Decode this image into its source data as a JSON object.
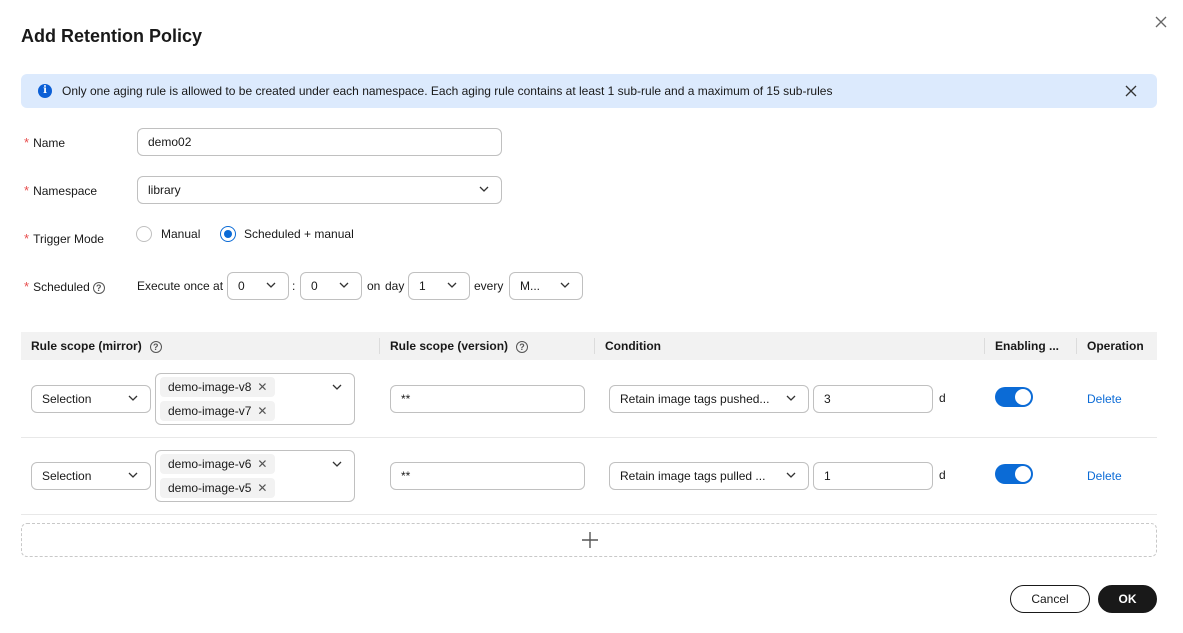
{
  "dialog": {
    "title": "Add Retention Policy"
  },
  "alert": {
    "text": "Only one aging rule is allowed to be created under each namespace. Each aging rule contains at least 1 sub-rule and a maximum of 15 sub-rules"
  },
  "form": {
    "name": {
      "label": "Name",
      "value": "demo02"
    },
    "namespace": {
      "label": "Namespace",
      "value": "library"
    },
    "trigger_mode": {
      "label": "Trigger Mode",
      "options": [
        "Manual",
        "Scheduled + manual"
      ],
      "selected": "Scheduled + manual"
    },
    "scheduled": {
      "label": "Scheduled",
      "prefix": "Execute once at",
      "hour": "0",
      "colon": ":",
      "minute": "0",
      "on_text": "on",
      "day_text": "day",
      "day": "1",
      "every_text": "every",
      "period": "M..."
    }
  },
  "table": {
    "headers": {
      "scope_mirror": "Rule scope (mirror)",
      "scope_version": "Rule scope (version)",
      "condition": "Condition",
      "enabling": "Enabling ...",
      "operation": "Operation"
    },
    "rows": [
      {
        "scope_select": "Selection",
        "tags": [
          "demo-image-v8",
          "demo-image-v7"
        ],
        "version": "**",
        "condition": "Retain image tags pushed...",
        "count": "3",
        "unit": "d",
        "enabled": true,
        "operation": "Delete"
      },
      {
        "scope_select": "Selection",
        "tags": [
          "demo-image-v6",
          "demo-image-v5"
        ],
        "version": "**",
        "condition": "Retain image tags pulled ...",
        "count": "1",
        "unit": "d",
        "enabled": true,
        "operation": "Delete"
      }
    ]
  },
  "footer": {
    "cancel": "Cancel",
    "ok": "OK"
  },
  "colors": {
    "accent": "#0b6bd6",
    "required": "#e84d4d",
    "alert_bg": "#dceafd"
  }
}
